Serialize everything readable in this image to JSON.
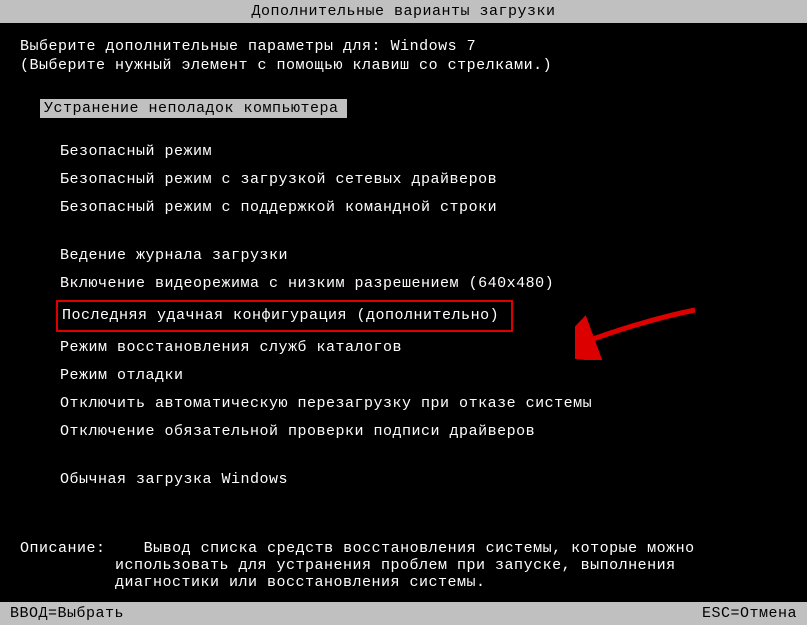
{
  "title": "Дополнительные варианты загрузки",
  "instruction_prefix": "Выберите дополнительные параметры для: ",
  "os_name": "Windows 7",
  "instruction_sub": "(Выберите нужный элемент с помощью клавиш со стрелками.)",
  "highlighted_option": "Устранение неполадок компьютера",
  "options_group1": [
    "Безопасный режим",
    "Безопасный режим с загрузкой сетевых драйверов",
    "Безопасный режим с поддержкой командной строки"
  ],
  "options_group2": [
    "Ведение журнала загрузки",
    "Включение видеорежима с низким разрешением (640x480)",
    "Последняя удачная конфигурация (дополнительно)",
    "Режим восстановления служб каталогов",
    "Режим отладки",
    "Отключить автоматическую перезагрузку при отказе системы",
    "Отключение обязательной проверки подписи драйверов"
  ],
  "boxed_option_index": 2,
  "options_group3": [
    "Обычная загрузка Windows"
  ],
  "description": {
    "label": "Описание:",
    "line1": "Вывод списка средств восстановления системы, которые можно",
    "line2": "использовать для устранения проблем при запуске, выполнения",
    "line3": "диагностики или восстановления системы."
  },
  "footer": {
    "left": "ВВОД=Выбрать",
    "right": "ESC=Отмена"
  },
  "annotation_color": "#d00"
}
